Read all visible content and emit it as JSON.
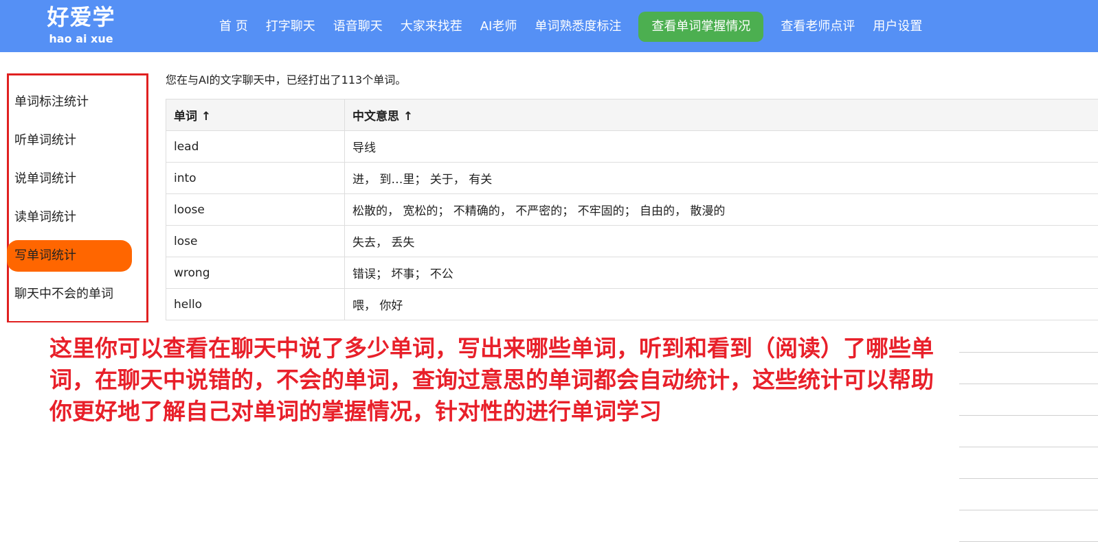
{
  "logo": {
    "cn": "好爱学",
    "en": "hao ai xue"
  },
  "nav": [
    "首 页",
    "打字聊天",
    "语音聊天",
    "大家来找茬",
    "AI老师",
    "单词熟悉度标注",
    "查看单词掌握情况",
    "查看老师点评",
    "用户设置"
  ],
  "nav_active": 6,
  "sidebar": [
    "单词标注统计",
    "听单词统计",
    "说单词统计",
    "读单词统计",
    "写单词统计",
    "聊天中不会的单词"
  ],
  "sidebar_active": 4,
  "message": "您在与AI的文字聊天中，已经打出了113个单词。",
  "table": {
    "headers": [
      "单词 ↑",
      "中文意思 ↑"
    ],
    "rows": [
      [
        "lead",
        "导线"
      ],
      [
        "into",
        "进， 到…里； 关于， 有关"
      ],
      [
        "loose",
        "松散的， 宽松的； 不精确的， 不严密的； 不牢固的； 自由的， 散漫的"
      ],
      [
        "lose",
        "失去， 丢失"
      ],
      [
        "wrong",
        "错误； 坏事； 不公"
      ],
      [
        "hello",
        "喂， 你好"
      ]
    ]
  },
  "annotation": "这里你可以查看在聊天中说了多少单词，写出来哪些单词，听到和看到（阅读）了哪些单词，在聊天中说错的，不会的单词，查询过意思的单词都会自动统计，这些统计可以帮助你更好地了解自己对单词的掌握情况，针对性的进行单词学习"
}
